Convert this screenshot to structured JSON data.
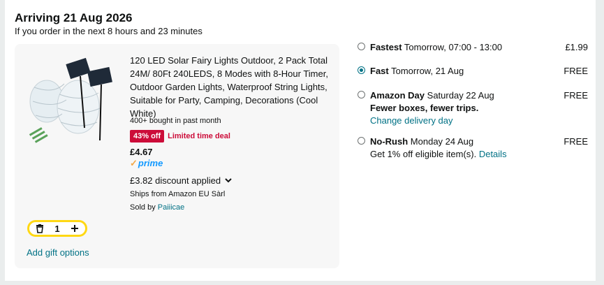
{
  "delivery": {
    "heading": "Arriving 21 Aug 2026",
    "note": "If you order in the next 8 hours and 23 minutes"
  },
  "item": {
    "title": "120 LED Solar Fairy Lights Outdoor, 2 Pack Total 24M/ 80Ft 240LEDS, 8 Modes with 8-Hour Timer, Outdoor Garden Lights, Waterproof String Lights, Suitable for Party, Camping, Decorations (Cool White)",
    "bought": "400+ bought in past month",
    "deal_badge": "43% off",
    "deal_text": "Limited time deal",
    "price": "£4.67",
    "prime_label": "prime",
    "discount": "£3.82 discount applied",
    "ships_from": "Ships from Amazon EU Sàrl",
    "sold_by_prefix": "Sold by ",
    "sold_by_name": "Paiiicae",
    "quantity": "1",
    "gift_options": "Add gift options"
  },
  "options": [
    {
      "name": "Fastest",
      "detail": "Tomorrow, 07:00 - 13:00",
      "price": "£1.99",
      "selected": false
    },
    {
      "name": "Fast",
      "detail": "Tomorrow, 21 Aug",
      "price": "FREE",
      "selected": true
    },
    {
      "name": "Amazon Day",
      "detail": "Saturday 22 Aug",
      "price": "FREE",
      "selected": false,
      "extra_bold": "Fewer boxes, fewer trips.",
      "extra_link": "Change delivery day"
    },
    {
      "name": "No-Rush",
      "detail": "Monday 24 Aug",
      "price": "FREE",
      "selected": false,
      "extra_text": "Get 1% off eligible item(s). ",
      "extra_link": "Details"
    }
  ],
  "colors": {
    "deal_red": "#cc0c39",
    "link_teal": "#007185",
    "qty_border_yellow": "#ffd814",
    "prime_blue": "#1399ff"
  },
  "icons": [
    "trash-icon",
    "plus-icon",
    "chevron-down-icon",
    "prime-check-icon"
  ]
}
